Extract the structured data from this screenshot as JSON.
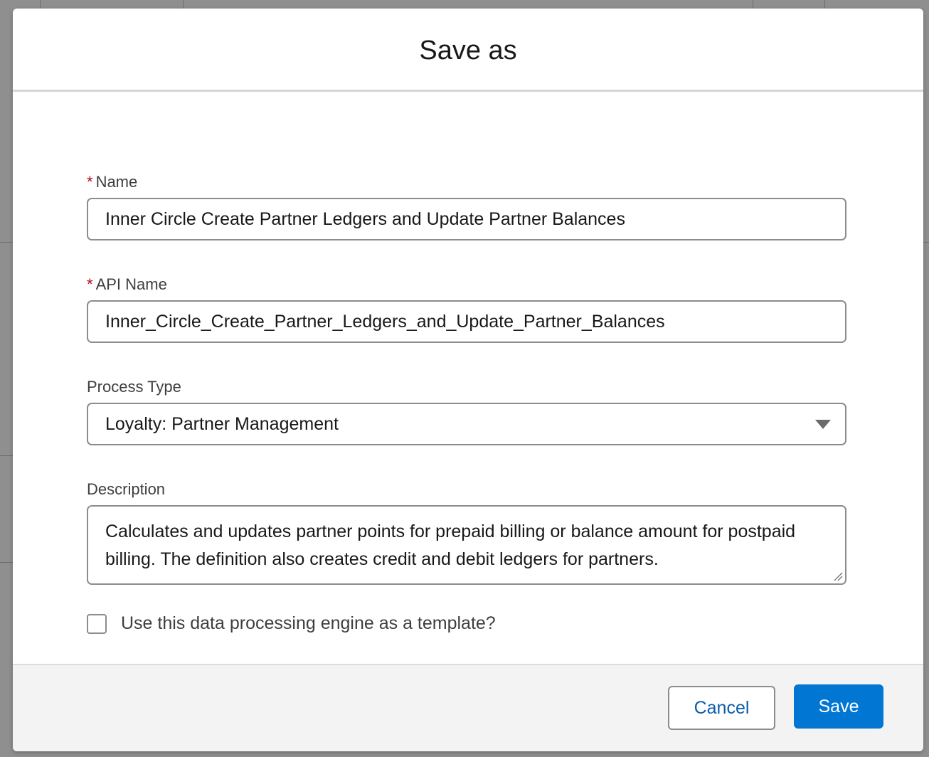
{
  "dialog": {
    "title": "Save as"
  },
  "fields": {
    "name": {
      "required_marker": "*",
      "label": "Name",
      "value": "Inner Circle Create Partner Ledgers and Update Partner Balances"
    },
    "api_name": {
      "required_marker": "*",
      "label": "API Name",
      "value": "Inner_Circle_Create_Partner_Ledgers_and_Update_Partner_Balances"
    },
    "process_type": {
      "label": "Process Type",
      "selected": "Loyalty: Partner Management"
    },
    "description": {
      "label": "Description",
      "value": "Calculates and updates partner points for prepaid billing or balance amount for postpaid billing. The definition also creates credit and debit ledgers for partners."
    },
    "template_checkbox": {
      "label": "Use this data processing engine as a template?",
      "checked": false
    }
  },
  "footer": {
    "cancel_label": "Cancel",
    "save_label": "Save"
  },
  "colors": {
    "brand": "#0176d3",
    "link": "#0b5cab",
    "required": "#ba0517"
  }
}
